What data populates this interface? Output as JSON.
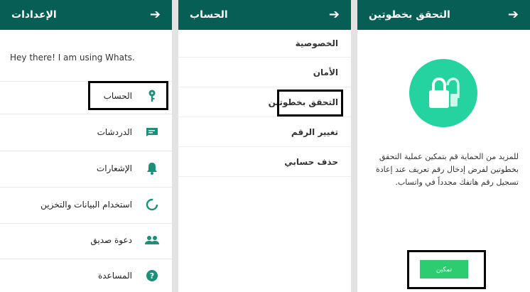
{
  "settings": {
    "title": "الإعدادات",
    "status": "Hey there! I am using Whats.",
    "items": [
      {
        "label": "الحساب",
        "icon": "key-icon"
      },
      {
        "label": "الدردشات",
        "icon": "chat-icon"
      },
      {
        "label": "الإشعارات",
        "icon": "bell-icon"
      },
      {
        "label": "استخدام البيانات والتخزين",
        "icon": "data-usage-icon"
      },
      {
        "label": "دعوة صديق",
        "icon": "people-icon"
      },
      {
        "label": "المساعدة",
        "icon": "help-icon"
      }
    ]
  },
  "account": {
    "title": "الحساب",
    "items": [
      {
        "label": "الخصوصية"
      },
      {
        "label": "الأمان"
      },
      {
        "label": "التحقق بخطوتين"
      },
      {
        "label": "تغيير الرقم"
      },
      {
        "label": "حذف حسابي"
      }
    ]
  },
  "two_step": {
    "title": "التحقق بخطوتين",
    "description": "للمزيد من الحماية قم بتمكين عملية التحقق بخطوتين لفرض إدخال رقم تعريف عند إعادة تسجيل رقم هاتفك مجدداً في واتساب.",
    "enable_label": "تمكين",
    "icon": "lock-icon"
  },
  "header_icon": "arrow-icon",
  "colors": {
    "header": "#075e54",
    "accent": "#1a8f7a",
    "lock_circle": "#25d3a0",
    "button": "#2ecc71"
  }
}
